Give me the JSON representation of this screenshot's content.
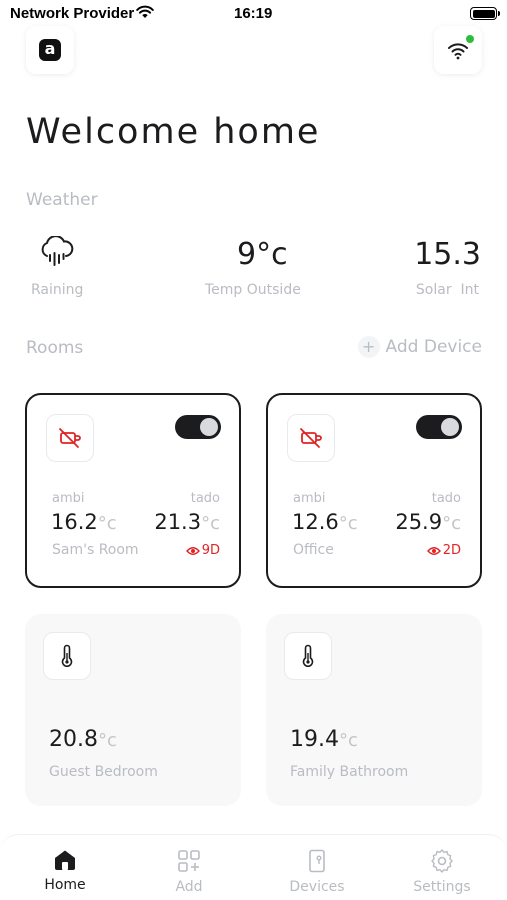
{
  "status_bar": {
    "carrier": "Network Provider",
    "time": "16:19"
  },
  "header": {
    "title": "Welcome home"
  },
  "weather": {
    "label": "Weather",
    "condition": "Raining",
    "temp_value": "9°c",
    "temp_caption": "Temp Outside",
    "solar_value": "15.3",
    "solar_caption": "Solar  Int"
  },
  "rooms": {
    "label": "Rooms",
    "add_device_label": "Add Device",
    "cards": [
      {
        "name": "Sam's Room",
        "ambi_label": "ambi",
        "tado_label": "tado",
        "ambi_temp": "16.2",
        "tado_temp": "21.3",
        "unit": "°c",
        "alert": "9D",
        "toggle_on": true
      },
      {
        "name": "Office",
        "ambi_label": "ambi",
        "tado_label": "tado",
        "ambi_temp": "12.6",
        "tado_temp": "25.9",
        "unit": "°c",
        "alert": "2D",
        "toggle_on": true
      },
      {
        "name": "Guest Bedroom",
        "temp": "20.8",
        "unit": "°c"
      },
      {
        "name": "Family Bathroom",
        "temp": "19.4",
        "unit": "°c"
      }
    ]
  },
  "tabs": [
    {
      "label": "Home",
      "icon": "home-icon",
      "selected": true
    },
    {
      "label": "Add",
      "icon": "grid-plus-icon",
      "selected": false
    },
    {
      "label": "Devices",
      "icon": "device-icon",
      "selected": false
    },
    {
      "label": "Settings",
      "icon": "gear-icon",
      "selected": false
    }
  ],
  "colors": {
    "accent": "#1c1c1e",
    "alert": "#e02424",
    "online": "#2ebd3a",
    "muted": "#b9bcc2"
  }
}
